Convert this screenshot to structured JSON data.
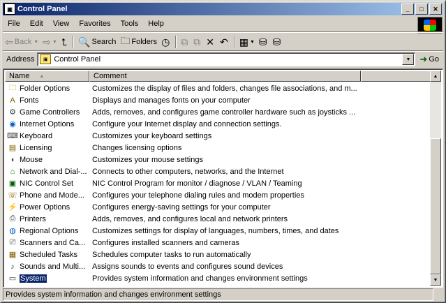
{
  "window": {
    "title": "Control Panel"
  },
  "menu": [
    "File",
    "Edit",
    "View",
    "Favorites",
    "Tools",
    "Help"
  ],
  "toolbar": {
    "back": "Back",
    "search": "Search",
    "folders": "Folders"
  },
  "address": {
    "label": "Address",
    "value": "Control Panel",
    "go": "Go"
  },
  "columns": {
    "name": "Name",
    "comment": "Comment"
  },
  "items": [
    {
      "name": "Folder Options",
      "comment": "Customizes the display of files and folders, changes file associations, and m...",
      "icon": "folder-options-icon"
    },
    {
      "name": "Fonts",
      "comment": "Displays and manages fonts on your computer",
      "icon": "fonts-icon"
    },
    {
      "name": "Game Controllers",
      "comment": "Adds, removes, and configures game controller hardware such as joysticks ...",
      "icon": "game-controllers-icon"
    },
    {
      "name": "Internet Options",
      "comment": "Configure your Internet display and connection settings.",
      "icon": "internet-options-icon"
    },
    {
      "name": "Keyboard",
      "comment": "Customizes your keyboard settings",
      "icon": "keyboard-icon"
    },
    {
      "name": "Licensing",
      "comment": "Changes licensing options",
      "icon": "licensing-icon"
    },
    {
      "name": "Mouse",
      "comment": "Customizes your mouse settings",
      "icon": "mouse-icon"
    },
    {
      "name": "Network and Dial-...",
      "comment": "Connects to other computers, networks, and the Internet",
      "icon": "network-icon"
    },
    {
      "name": "NIC Control Set",
      "comment": "NIC Control Program for monitor / diagnose / VLAN / Teaming",
      "icon": "nic-control-icon"
    },
    {
      "name": "Phone and Mode...",
      "comment": "Configures your telephone dialing rules and modem properties",
      "icon": "phone-modem-icon"
    },
    {
      "name": "Power Options",
      "comment": "Configures energy-saving settings for your computer",
      "icon": "power-options-icon"
    },
    {
      "name": "Printers",
      "comment": "Adds, removes, and configures local and network printers",
      "icon": "printers-icon"
    },
    {
      "name": "Regional Options",
      "comment": "Customizes settings for display of languages, numbers, times, and dates",
      "icon": "regional-options-icon"
    },
    {
      "name": "Scanners and Ca...",
      "comment": "Configures installed scanners and cameras",
      "icon": "scanners-cameras-icon"
    },
    {
      "name": "Scheduled Tasks",
      "comment": "Schedules computer tasks to run automatically",
      "icon": "scheduled-tasks-icon"
    },
    {
      "name": "Sounds and Multi...",
      "comment": "Assigns sounds to events and configures sound devices",
      "icon": "sounds-icon"
    },
    {
      "name": "System",
      "comment": "Provides system information and changes environment settings",
      "icon": "system-icon",
      "selected": true
    }
  ],
  "status": {
    "text": "Provides system information and changes environment settings"
  }
}
